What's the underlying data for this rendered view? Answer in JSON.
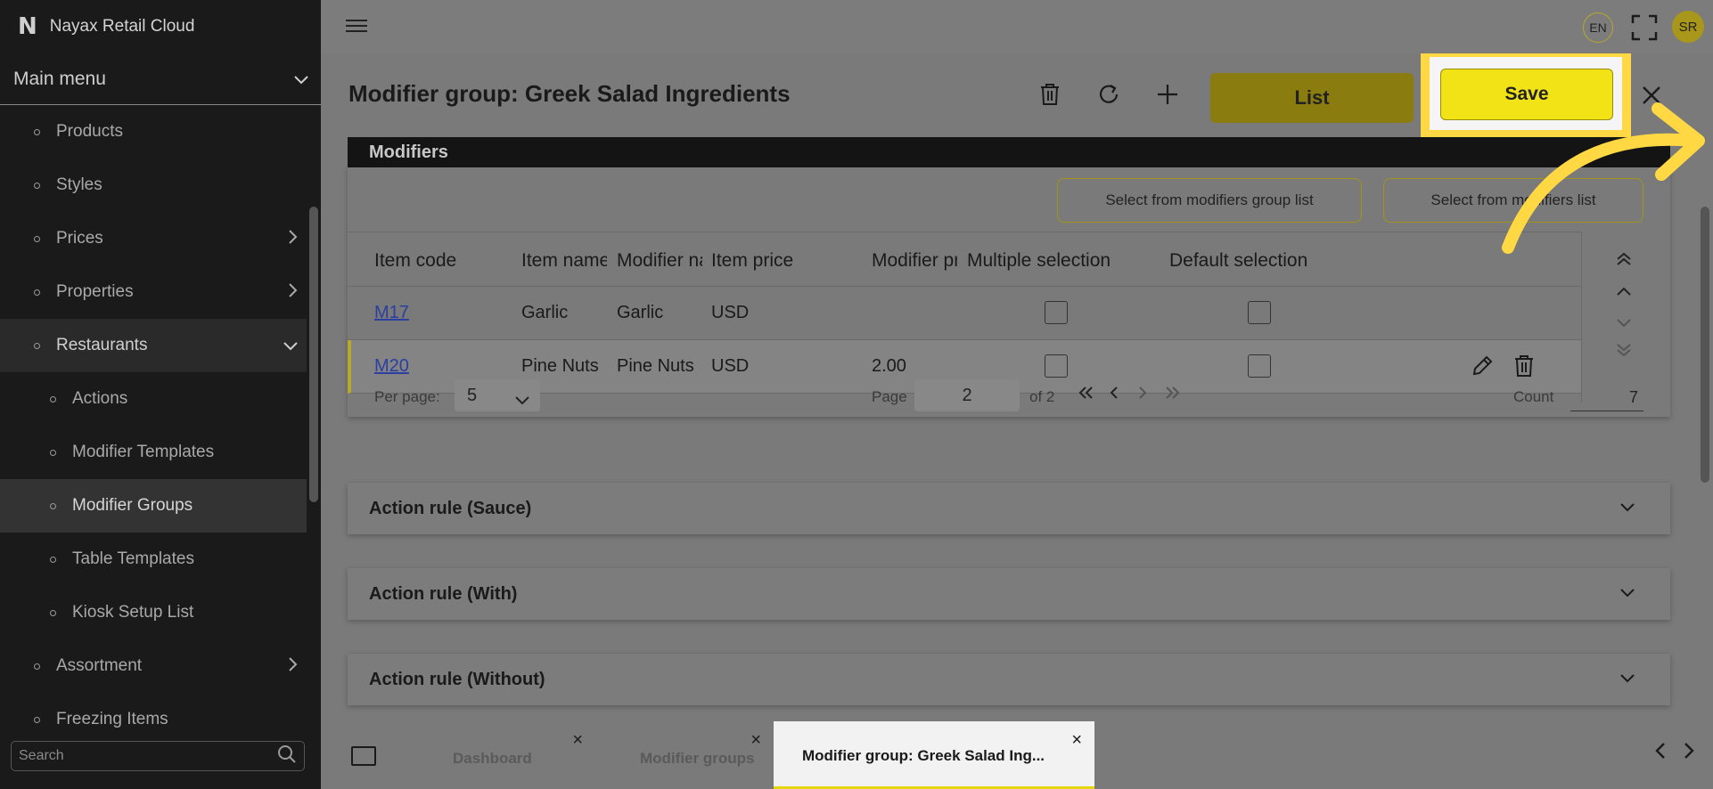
{
  "brand": {
    "logo": "N",
    "name": "Nayax Retail Cloud"
  },
  "sidebar": {
    "main_menu": "Main menu",
    "items": [
      {
        "label": "Products",
        "level": 1,
        "chevron": ""
      },
      {
        "label": "Styles",
        "level": 1,
        "chevron": ""
      },
      {
        "label": "Prices",
        "level": 1,
        "chevron": "›"
      },
      {
        "label": "Properties",
        "level": 1,
        "chevron": "›"
      },
      {
        "label": "Restaurants",
        "level": 1,
        "chevron": "⌄"
      },
      {
        "label": "Actions",
        "level": 2,
        "chevron": ""
      },
      {
        "label": "Modifier Templates",
        "level": 2,
        "chevron": ""
      },
      {
        "label": "Modifier Groups",
        "level": 2,
        "chevron": ""
      },
      {
        "label": "Table Templates",
        "level": 2,
        "chevron": ""
      },
      {
        "label": "Kiosk Setup List",
        "level": 2,
        "chevron": ""
      },
      {
        "label": "Assortment",
        "level": 1,
        "chevron": "›"
      },
      {
        "label": "Freezing Items",
        "level": 1,
        "chevron": ""
      }
    ],
    "search_placeholder": "Search"
  },
  "topbar": {
    "lang": "EN",
    "avatar": "SR"
  },
  "page": {
    "title": "Modifier group: Greek Salad Ingredients",
    "list_label": "List",
    "save_label": "Save"
  },
  "modifiers": {
    "heading": "Modifiers",
    "select_group_btn": "Select from modifiers group list",
    "select_list_btn": "Select from modifiers list",
    "columns": [
      "Item code",
      "Item name",
      "Modifier name",
      "Item price",
      "Modifier price",
      "Multiple selection",
      "Default selection"
    ],
    "rows": [
      {
        "code": "M17",
        "item_name": "Garlic",
        "modifier_name": "Garlic",
        "item_price": "USD",
        "modifier_price": ""
      },
      {
        "code": "M20",
        "item_name": "Pine Nuts",
        "modifier_name": "Pine Nuts",
        "item_price": "USD",
        "modifier_price": "2.00"
      }
    ],
    "pager": {
      "per_page_label": "Per page:",
      "per_page": "5",
      "page_label": "Page",
      "page": "2",
      "of_label": "of 2",
      "count_label": "Count",
      "count": "7"
    }
  },
  "accordions": [
    "Action rule (Sauce)",
    "Action rule (With)",
    "Action rule (Without)"
  ],
  "tabs": [
    "Dashboard",
    "Modifier groups",
    "Modifier group: Greek Salad Ing..."
  ],
  "colors": {
    "accent": "#f2e316",
    "highlight": "#ffd843",
    "sidebar": "#1a1a1a"
  }
}
